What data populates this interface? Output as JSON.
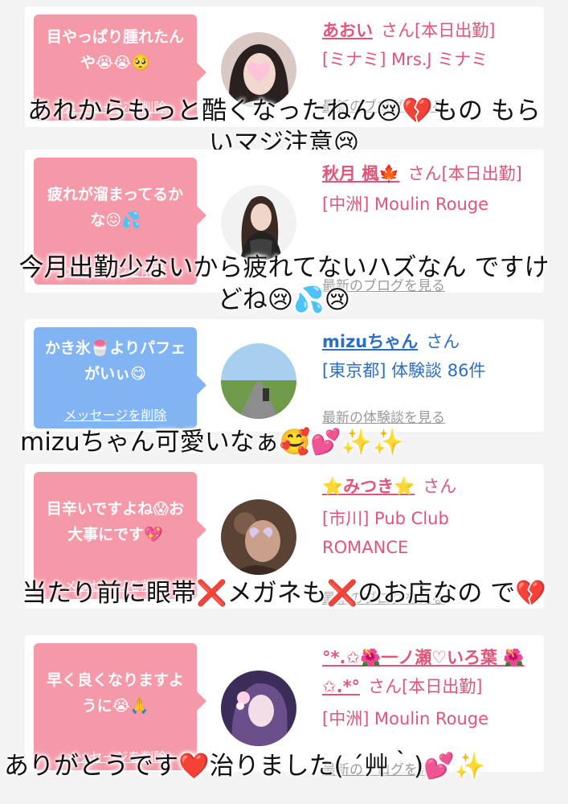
{
  "entries": [
    {
      "message": "目やっぱり腫れたんや😭😭🥺",
      "delete_label": "メッセージを削除",
      "name": "あおい",
      "san": "さん[本日出勤]",
      "shop": "[ミナミ] Mrs.J ミナミ",
      "link": "最新のブログを見る",
      "caption": "あれからもっと酷くなったねん😢💔もの もらいマジ注意😢"
    },
    {
      "message": "疲れが溜まってるかな😖💦",
      "delete_label": "メッセージを削除",
      "name": "秋月 楓🍁",
      "san": "さん[本日出勤]",
      "shop": "[中洲] Moulin Rouge",
      "link": "最新のブログを見る",
      "caption": "今月出勤少ないから疲れてないハズなん ですけどね😢💦😢"
    },
    {
      "message": "かき氷🍧よりパフェがいぃ😋",
      "delete_label": "メッセージを削除",
      "name": "mizuちゃん",
      "san": "さん",
      "shop": "[東京都] 体験談 86件",
      "link": "最新の体験談を見る",
      "caption": "mizuちゃん可愛いなぁ🥰💕✨✨"
    },
    {
      "message": "目辛いですよね😱お大事にです💖",
      "delete_label": "メッセージを削除",
      "name": "⭐みつき⭐",
      "san": "さん",
      "shop": "[市川] Pub Club ROMANCE",
      "link": "最新のブログを見る",
      "caption": "当たり前に眼帯❌メガネも❌のお店なの で💔"
    },
    {
      "message": "早く良くなりますように😭🙏",
      "delete_label": "メッセージを削除",
      "name": "°*.✩🌺一ノ瀬♡いろ葉 🌺✩.*°",
      "san": "さん[本日出勤]",
      "shop": "[中洲] Moulin Rouge",
      "link": "最新のブログを見る",
      "caption": "ありがとうです❤️治りました( ´艸｀)💕✨"
    }
  ]
}
